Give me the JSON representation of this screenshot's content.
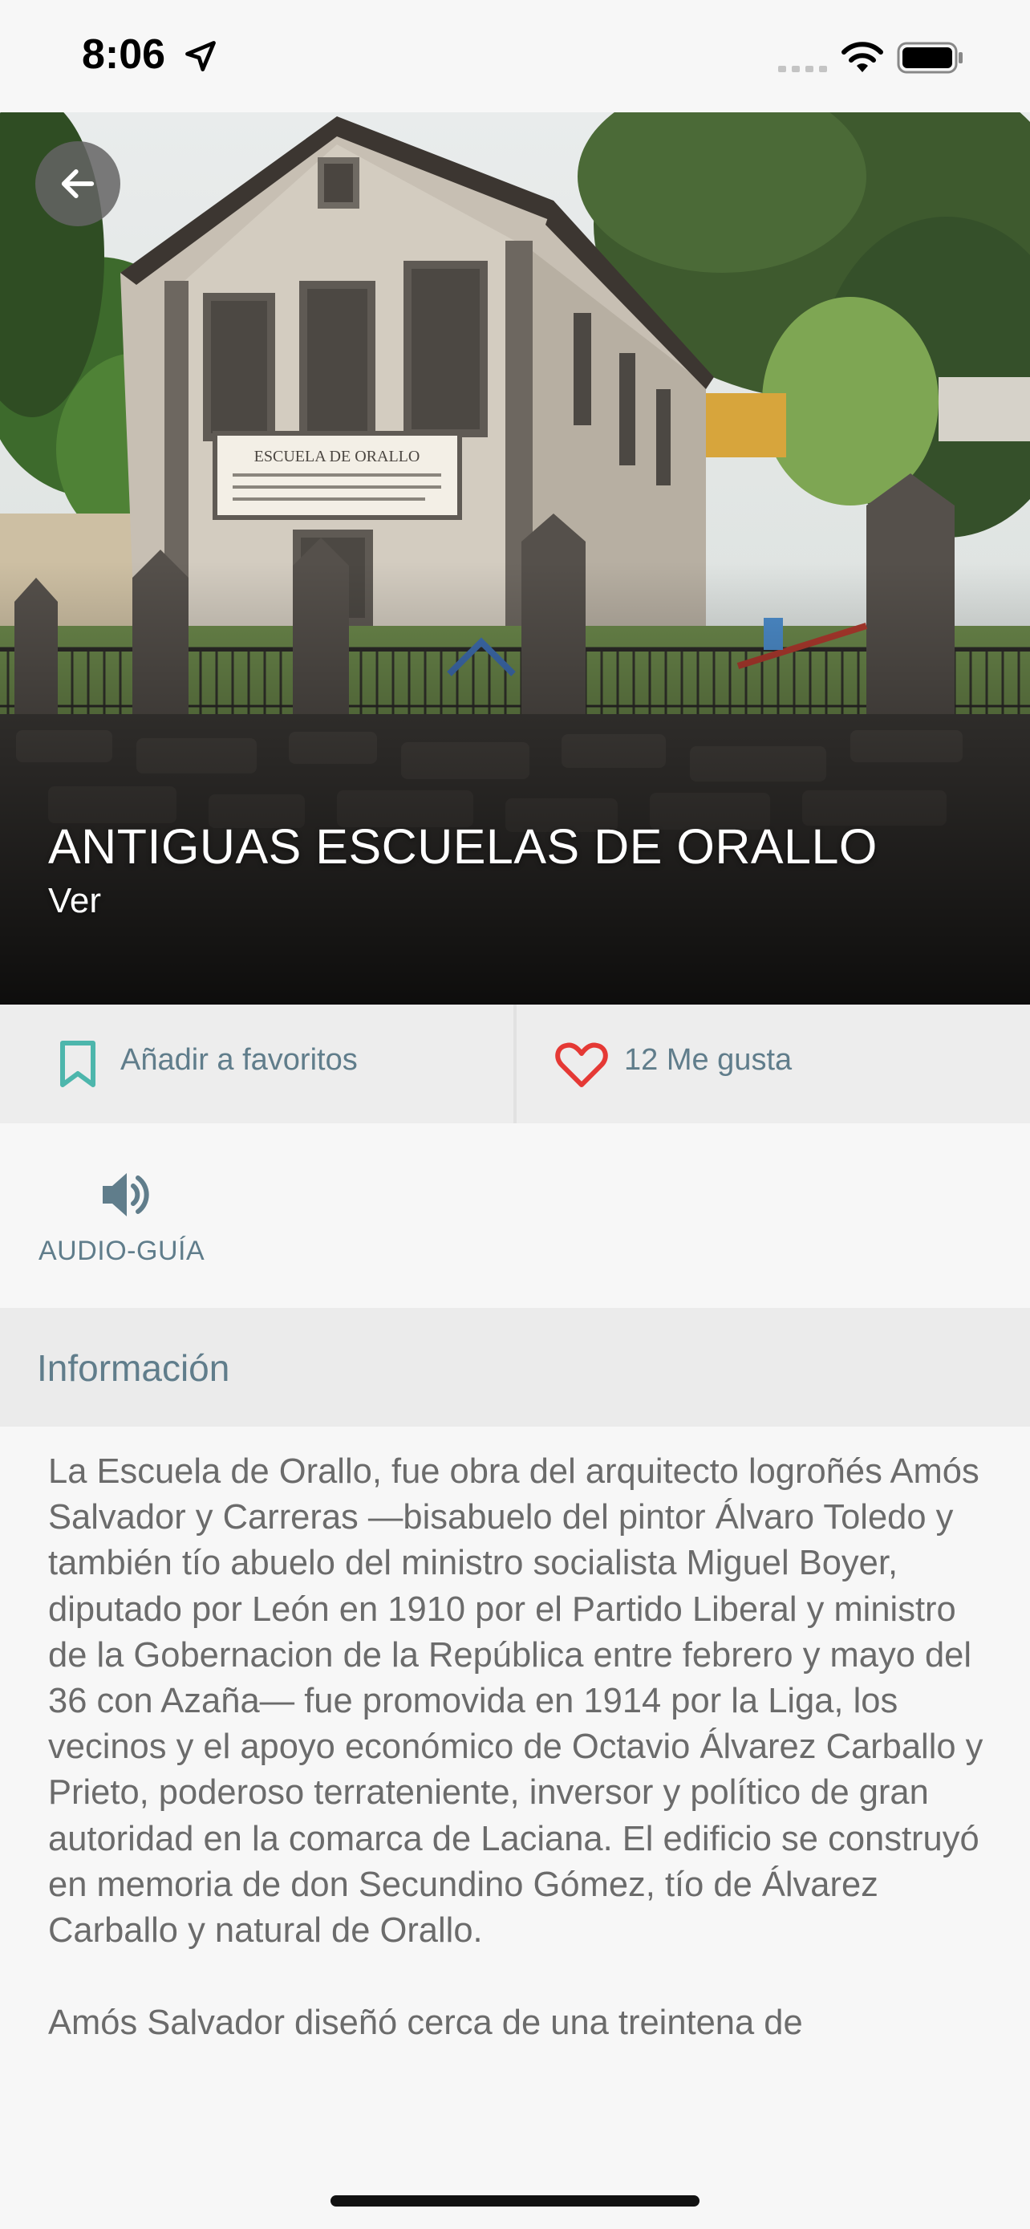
{
  "status_bar": {
    "time": "8:06"
  },
  "hero": {
    "title": "ANTIGUAS ESCUELAS DE ORALLO",
    "subtitle": "Ver",
    "sign_text": [
      "ESCUELA DE ORALLO"
    ]
  },
  "actions": {
    "favorites_label": "Añadir a favoritos",
    "likes_label": "12 Me gusta"
  },
  "audio_guide": {
    "label": "AUDIO-GUÍA"
  },
  "info": {
    "header": "Información",
    "paragraphs": [
      "La Escuela de Orallo, fue obra del arquitecto logroñés Amós Salvador y Carreras —bisabuelo del pintor Álvaro Toledo y también tío abuelo del ministro socialista Miguel Boyer, diputado por León en 1910 por el Partido Liberal y ministro de la Gobernacion de la República entre febrero y mayo del 36 con Azaña— fue promovida en 1914 por la Liga, los vecinos y el apoyo económico de Octavio Álvarez Carballo y Prieto, poderoso terrateniente, inversor y político de gran autoridad en la comarca de Laciana. El edificio se construyó en memoria de don Secundino Gómez, tío de Álvarez Carballo y natural de Orallo.",
      "Amós Salvador diseñó cerca de una treintena de"
    ]
  },
  "colors": {
    "accent": "#607d8b",
    "bookmark": "#4db6ac",
    "heart": "#e53935"
  }
}
